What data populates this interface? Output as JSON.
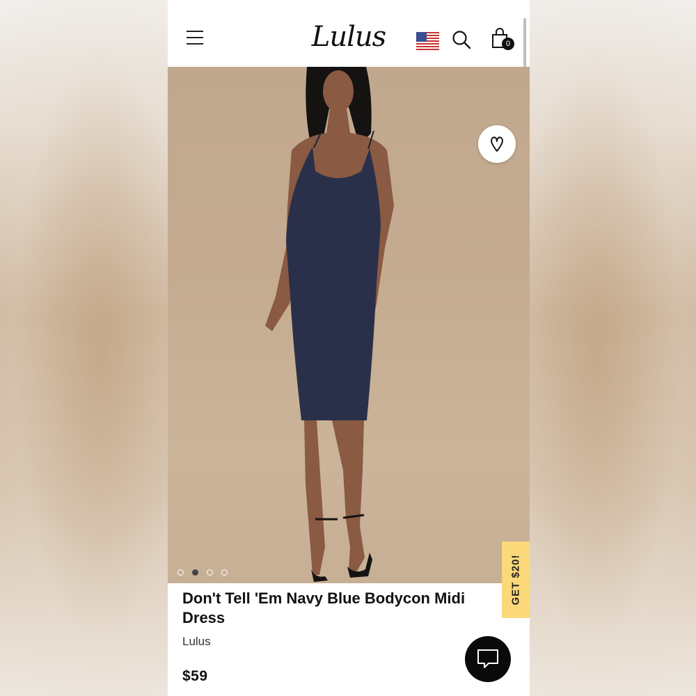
{
  "header": {
    "logo_text": "Lulus",
    "cart_count": "0",
    "menu_icon": "hamburger-menu-icon",
    "search_icon": "search-icon",
    "bag_icon": "shopping-bag-icon",
    "flag_icon": "us-flag-icon"
  },
  "product": {
    "title": "Don't Tell 'Em Navy Blue Bodycon Midi Dress",
    "brand": "Lulus",
    "price": "$59",
    "image_count": 4,
    "active_image_index": 1
  },
  "promo": {
    "label": "GET $20!"
  },
  "colors": {
    "accent_promo": "#fbd97a",
    "dress": "#2a3049",
    "background": "#c4ab90"
  }
}
